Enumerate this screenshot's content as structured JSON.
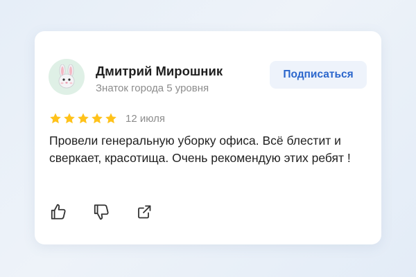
{
  "review": {
    "author": {
      "name": "Дмитрий Мирошник",
      "subtitle": "Знаток города 5 уровня",
      "avatar_icon": "bunny-emoji"
    },
    "subscribe_label": "Подписаться",
    "rating": 5,
    "date": "12 июля",
    "text": "Провели генеральную уборку офиса. Всё блестит и сверкает, красотища. Очень рекомендую этих ребят !",
    "actions": [
      "thumbs-up-icon",
      "thumbs-down-icon",
      "share-icon"
    ]
  },
  "colors": {
    "star": "#ffc21a",
    "accent": "#2b66cc",
    "avatar_bg": "#dff0e6"
  }
}
